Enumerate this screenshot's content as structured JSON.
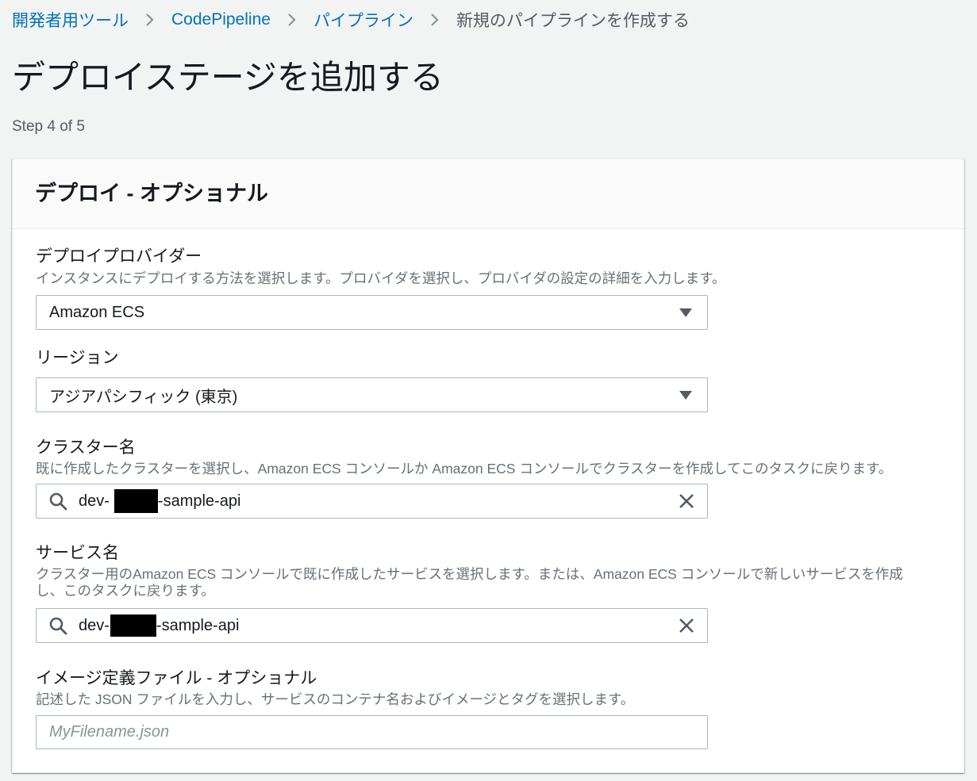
{
  "breadcrumb": {
    "items": [
      {
        "label": "開発者用ツール"
      },
      {
        "label": "CodePipeline"
      },
      {
        "label": "パイプライン"
      },
      {
        "label": "新規のパイプラインを作成する"
      }
    ]
  },
  "page": {
    "title": "デプロイステージを追加する",
    "step_indicator": "Step 4 of 5"
  },
  "deploy_panel": {
    "title": "デプロイ - オプショナル",
    "provider": {
      "label": "デプロイプロバイダー",
      "description": "インスタンスにデプロイする方法を選択します。プロバイダを選択し、プロバイダの設定の詳細を入力します。",
      "value": "Amazon ECS"
    },
    "region": {
      "label": "リージョン",
      "value": "アジアパシフィック (東京)"
    },
    "cluster": {
      "label": "クラスター名",
      "description": "既に作成したクラスターを選択し、Amazon ECS コンソールか Amazon ECS コンソールでクラスターを作成してこのタスクに戻ります。",
      "value_visible_start": "dev-",
      "value_visible_end": "-sample-api"
    },
    "service": {
      "label": "サービス名",
      "description": "クラスター用のAmazon ECS コンソールで既に作成したサービスを選択します。または、Amazon ECS コンソールで新しいサービスを作成し、このタスクに戻ります。",
      "value_visible_start": "dev-",
      "value_visible_end": "-sample-api"
    },
    "image_definitions": {
      "label": "イメージ定義ファイル - オプショナル",
      "description": "記述した JSON ファイルを入力し、サービスのコンテナ名およびイメージとタグを選択します。",
      "value": "",
      "placeholder": "MyFilename.json"
    }
  },
  "colors": {
    "page_background": "#f2f3f3",
    "link": "#0073bb",
    "text": "#16191f",
    "secondary_text": "#687078",
    "input_border": "#aab7b8",
    "panel_header_background": "#fafafa"
  },
  "icons": {
    "breadcrumb_separator": "chevron-right-icon",
    "select_caret": "caret-down-icon",
    "search": "search-icon",
    "clear": "close-icon"
  }
}
